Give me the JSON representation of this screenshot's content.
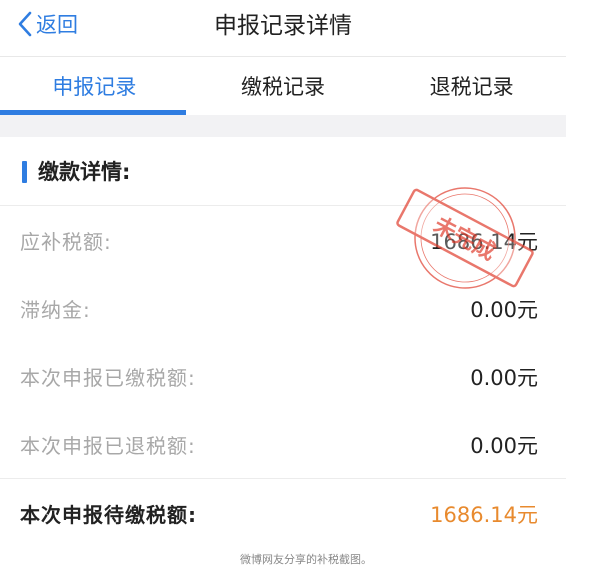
{
  "nav": {
    "back_label": "返回",
    "title": "申报记录详情"
  },
  "tabs": [
    {
      "label": "申报记录",
      "active": true
    },
    {
      "label": "缴税记录",
      "active": false
    },
    {
      "label": "退税记录",
      "active": false
    }
  ],
  "section": {
    "title": "缴款详情:"
  },
  "rows": [
    {
      "label": "应补税额:",
      "value": "1686.14元"
    },
    {
      "label": "滞纳金:",
      "value": "0.00元"
    },
    {
      "label": "本次申报已缴税额:",
      "value": "0.00元"
    },
    {
      "label": "本次申报已退税额:",
      "value": "0.00元"
    }
  ],
  "total": {
    "label": "本次申报待缴税额:",
    "value": "1686.14元"
  },
  "stamp": {
    "text": "未完成"
  },
  "caption": "微博网友分享的补税截图。",
  "colors": {
    "accent": "#2f7de1",
    "amount_due": "#e88a2e",
    "stamp": "#e24a3b"
  }
}
